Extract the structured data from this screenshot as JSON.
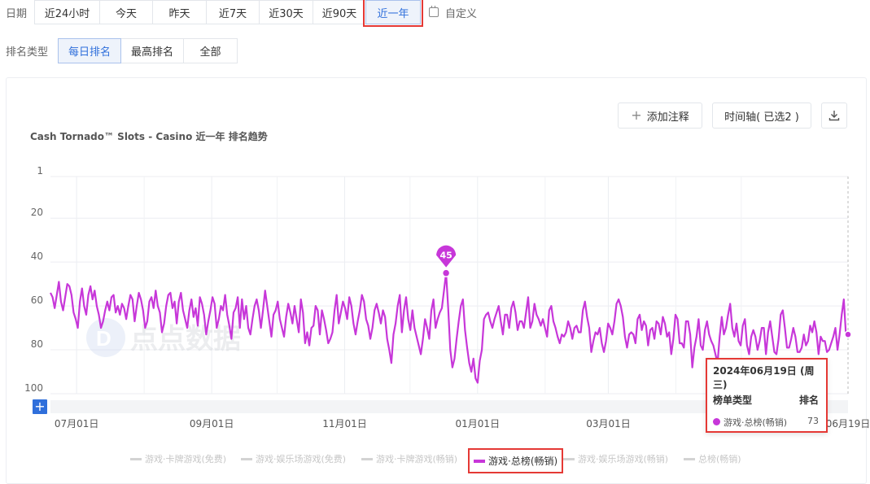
{
  "filters": {
    "date_label": "日期",
    "date_options": [
      "近24小时",
      "今天",
      "昨天",
      "近7天",
      "近30天",
      "近90天",
      "近一年"
    ],
    "date_selected": "近一年",
    "custom_label": "自定义",
    "rank_type_label": "排名类型",
    "rank_options": [
      "每日排名",
      "最高排名",
      "全部"
    ],
    "rank_selected": "每日排名"
  },
  "toolbar": {
    "add_note_label": "添加注释",
    "timeline_label": "时间轴( 已选2 )",
    "download_icon": "download-icon"
  },
  "watermark": "点点数据",
  "zoom_button_label": "+",
  "chart_data": {
    "type": "line",
    "title": "Cash Tornado™ Slots - Casino 近一年 排名趋势",
    "y_inverted": true,
    "ylim": [
      1,
      100
    ],
    "y_ticks": [
      "1",
      "20",
      "40",
      "60",
      "80",
      "100"
    ],
    "x_ticks": [
      "07月01日",
      "09月01日",
      "11月01日",
      "01月01日",
      "03月01日",
      "06月19日"
    ],
    "x_range": [
      "2023-06-19",
      "2024-06-19"
    ],
    "series": [
      {
        "name": "游戏·总榜(畅销)",
        "color": "#c737d9",
        "values": [
          54,
          56,
          61,
          55,
          49,
          58,
          62,
          56,
          50,
          51,
          55,
          63,
          66,
          70,
          58,
          52,
          60,
          64,
          55,
          51,
          57,
          53,
          60,
          64,
          70,
          67,
          62,
          58,
          62,
          56,
          55,
          63,
          60,
          64,
          59,
          61,
          66,
          60,
          55,
          57,
          67,
          60,
          54,
          57,
          62,
          70,
          67,
          58,
          56,
          61,
          53,
          60,
          63,
          72,
          68,
          60,
          55,
          54,
          61,
          58,
          68,
          58,
          54,
          62,
          66,
          70,
          62,
          57,
          65,
          61,
          69,
          56,
          59,
          64,
          73,
          67,
          62,
          56,
          59,
          70,
          66,
          60,
          62,
          55,
          64,
          69,
          75,
          63,
          61,
          56,
          70,
          57,
          66,
          60,
          70,
          73,
          66,
          60,
          57,
          62,
          70,
          62,
          53,
          60,
          67,
          74,
          64,
          62,
          58,
          66,
          70,
          74,
          65,
          59,
          63,
          68,
          60,
          66,
          72,
          57,
          63,
          77,
          72,
          78,
          70,
          69,
          60,
          62,
          73,
          62,
          66,
          71,
          77,
          75,
          72,
          62,
          55,
          68,
          63,
          58,
          61,
          66,
          56,
          60,
          68,
          73,
          67,
          62,
          55,
          58,
          66,
          69,
          75,
          70,
          62,
          59,
          63,
          68,
          62,
          65,
          75,
          80,
          86,
          73,
          68,
          60,
          55,
          72,
          62,
          56,
          66,
          71,
          62,
          70,
          74,
          78,
          82,
          75,
          66,
          70,
          75,
          62,
          57,
          70,
          66,
          63,
          61,
          53,
          45,
          61,
          80,
          88,
          84,
          75,
          67,
          60,
          57,
          71,
          79,
          86,
          90,
          84,
          93,
          95,
          85,
          80,
          66,
          64,
          63,
          67,
          70,
          66,
          63,
          60,
          67,
          73,
          64,
          64,
          70,
          61,
          58,
          63,
          71,
          67,
          67,
          70,
          63,
          56,
          70,
          67,
          59,
          64,
          66,
          69,
          66,
          70,
          74,
          62,
          60,
          67,
          70,
          74,
          77,
          73,
          74,
          72,
          67,
          70,
          75,
          70,
          69,
          72,
          72,
          62,
          58,
          65,
          70,
          81,
          76,
          72,
          73,
          70,
          77,
          81,
          76,
          68,
          70,
          73,
          67,
          59,
          57,
          60,
          65,
          74,
          79,
          73,
          72,
          73,
          77,
          66,
          64,
          71,
          67,
          69,
          78,
          71,
          70,
          75,
          67,
          68,
          73,
          65,
          68,
          74,
          72,
          82,
          75,
          64,
          66,
          77,
          77,
          79,
          67,
          67,
          73,
          88,
          79,
          74,
          66,
          78,
          80,
          71,
          67,
          73,
          76,
          78,
          82,
          86,
          74,
          65,
          73,
          70,
          64,
          59,
          70,
          74,
          68,
          76,
          78,
          69,
          66,
          78,
          82,
          74,
          71,
          74,
          80,
          76,
          70,
          70,
          82,
          72,
          67,
          74,
          81,
          82,
          75,
          64,
          62,
          70,
          79,
          79,
          75,
          70,
          74,
          81,
          81,
          79,
          73,
          78,
          76,
          69,
          72,
          67,
          72,
          82,
          74,
          76,
          76,
          81,
          80,
          77,
          74,
          70,
          80,
          73,
          64,
          57,
          73,
          73
        ]
      }
    ],
    "legend": [
      {
        "name": "游戏·卡牌游戏(免费)",
        "active": false
      },
      {
        "name": "游戏·娱乐场游戏(免费)",
        "active": false
      },
      {
        "name": "游戏·卡牌游戏(畅销)",
        "active": false
      },
      {
        "name": "游戏·总榜(畅销)",
        "active": true
      },
      {
        "name": "游戏·娱乐场游戏(畅销)",
        "active": false
      },
      {
        "name": "总榜(畅销)",
        "active": false
      }
    ],
    "legend_placement": "bottom",
    "annotation": {
      "label": "45",
      "value": 45
    }
  },
  "tooltip": {
    "date": "2024年06月19日 (周三)",
    "col_type": "榜单类型",
    "col_rank": "排名",
    "series": "游戏·总榜(畅销)",
    "value": "73"
  }
}
